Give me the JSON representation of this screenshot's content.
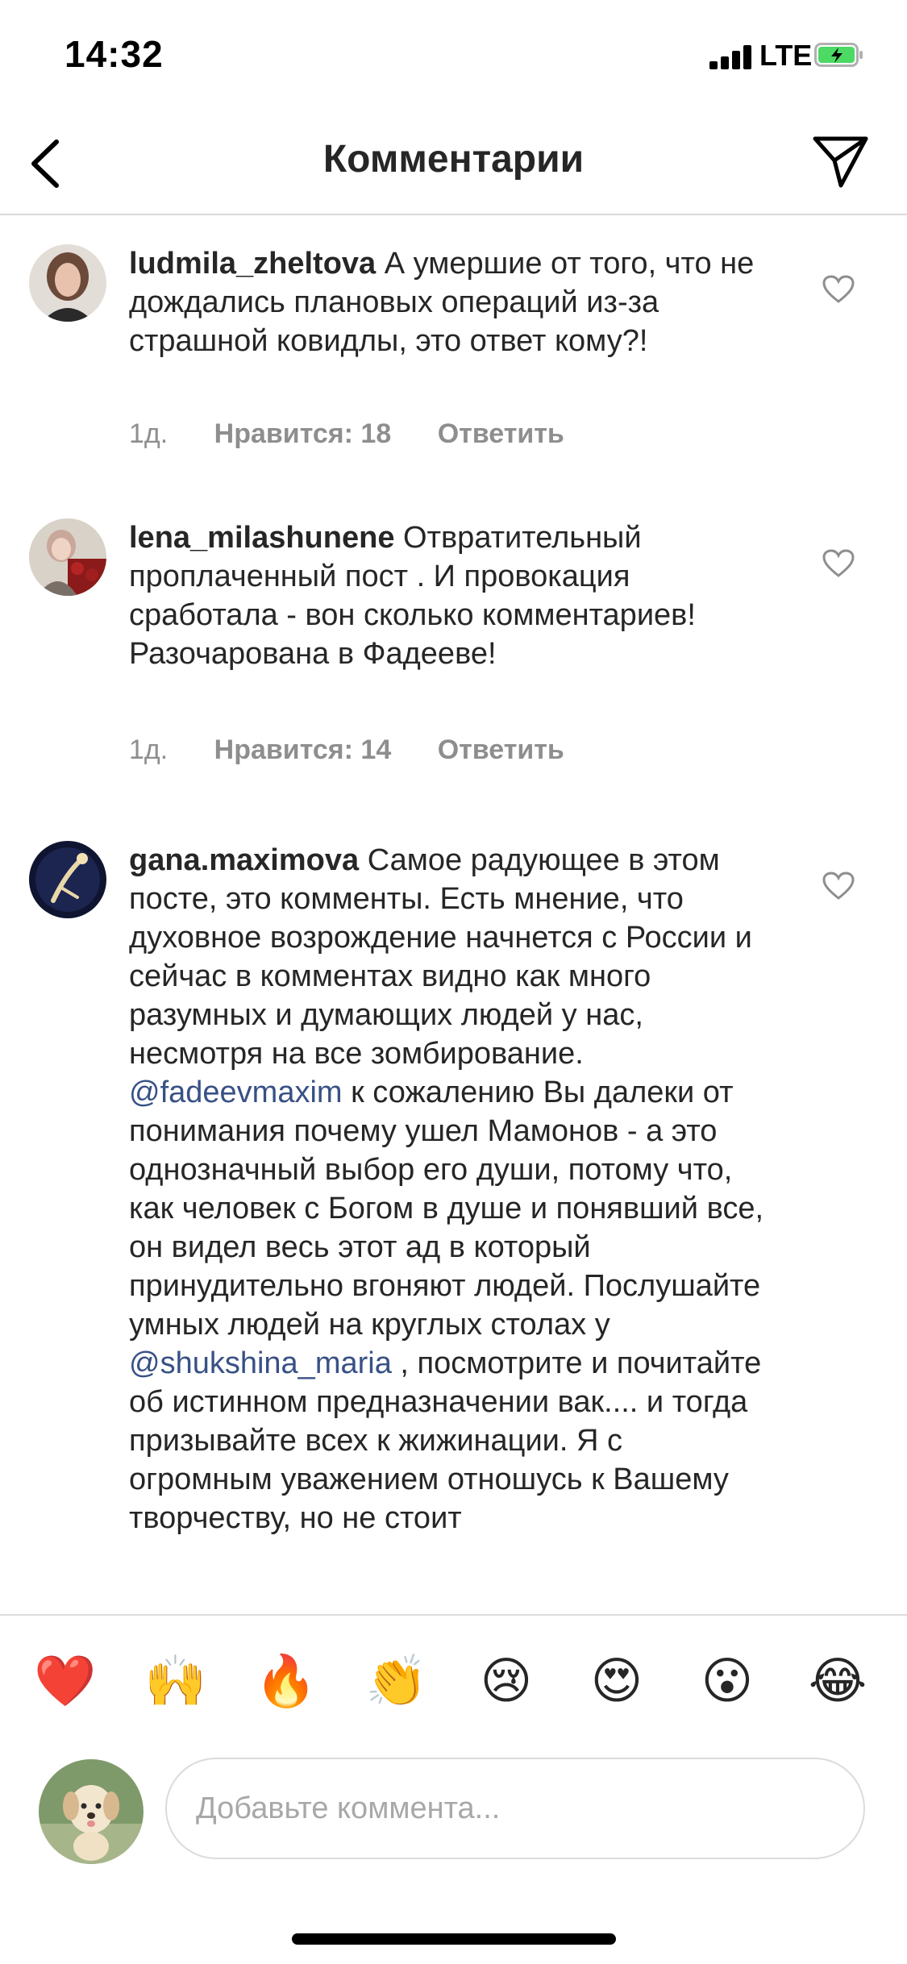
{
  "status_bar": {
    "time": "14:32",
    "network": "LTE",
    "battery_color": "#4cd964"
  },
  "header": {
    "title": "Комментарии",
    "back_icon": "chevron-left-icon",
    "send_icon": "paper-plane-icon"
  },
  "comments": [
    {
      "username": "ludmila_zheltova",
      "text": "А умершие от того, что не дождались плановых операций из-за страшной ковидлы, это ответ кому?!",
      "time": "1д.",
      "likes": "Нравится: 18",
      "reply": "Ответить"
    },
    {
      "username": "lena_milashunene",
      "text": "Отвратительный проплаченный пост . И провокация сработала - вон сколько комментариев! Разочарована в Фадееве!",
      "time": "1д.",
      "likes": "Нравится: 14",
      "reply": "Ответить"
    },
    {
      "username": "gana.maximova",
      "text_1": "Самое радующее в этом посте, это комменты.  Есть мнение, что духовное возрождение начнется с России и сейчас в комментах видно как много разумных и думающих людей у нас, несмотря на все зомбирование. ",
      "mention_1": "@fadeevmaxim",
      "text_2": " к сожалению Вы далеки от понимания почему ушел Мамонов - а это однозначный выбор его души, потому что, как человек с Богом в душе и понявший все, он видел весь этот ад в который принудительно вгоняют людей. Послушайте умных людей на круглых столах у ",
      "mention_2": "@shukshina_maria",
      "text_3": " , посмотрите и почитайте об истинном предназначении вак.... и тогда призывайте всех к жижинации. Я с огромным уважением отношусь к Вашему творчеству, но не стоит"
    }
  ],
  "emoji_bar": [
    "❤️",
    "🙌",
    "🔥",
    "👏",
    "😢",
    "😍",
    "😮",
    "😂"
  ],
  "input": {
    "placeholder": "Добавьте коммента..."
  },
  "colors": {
    "mention": "#385185",
    "meta": "#8e8e8e",
    "divider": "#dbdbdb"
  }
}
